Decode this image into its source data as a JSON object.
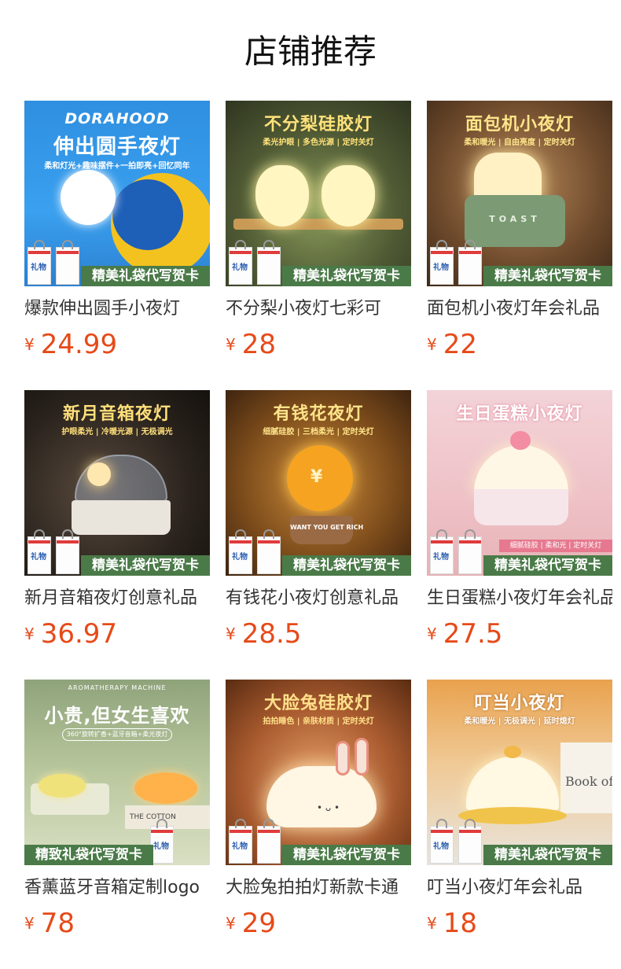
{
  "page": {
    "title": "店铺推荐"
  },
  "gift_banner": "精美礼袋代写贺卡",
  "products": [
    {
      "name": "爆款伸出圆手小夜灯",
      "currency": "¥",
      "price": "24.99",
      "image": {
        "brand": "DORAHOOD",
        "headline": "伸出圆手夜灯",
        "subline": "柔和灯光+趣味摆件+一拍即亮+回忆同年",
        "theme": "blue"
      }
    },
    {
      "name": "不分梨小夜灯七彩可",
      "currency": "¥",
      "price": "28",
      "image": {
        "headline": "不分梨硅胶灯",
        "subline": "柔光护眼 | 多色光源 | 定时关灯",
        "theme": "green-amber"
      }
    },
    {
      "name": "面包机小夜灯年会礼品",
      "currency": "¥",
      "price": "22",
      "image": {
        "headline": "面包机小夜灯",
        "subline": "柔和暖光 | 自由亮度 | 定时关灯",
        "theme": "warm-brown",
        "product_text": "TOAST"
      }
    },
    {
      "name": "新月音箱夜灯创意礼品",
      "currency": "¥",
      "price": "36.97",
      "image": {
        "headline": "新月音箱夜灯",
        "subline": "护眼柔光 | 冷暖光源 | 无极调光",
        "theme": "dark"
      }
    },
    {
      "name": "有钱花小夜灯创意礼品",
      "currency": "¥",
      "price": "28.5",
      "image": {
        "headline": "有钱花夜灯",
        "subline": "细腻硅胶 | 三档柔光 | 定时关灯",
        "theme": "orange",
        "product_text": "WANT YOU GET RICH"
      }
    },
    {
      "name": "生日蛋糕小夜灯年会礼品",
      "currency": "¥",
      "price": "27.5",
      "image": {
        "headline": "生日蛋糕小夜灯",
        "subline": "细腻硅胶 | 柔和光 | 定时关灯",
        "theme": "pink"
      }
    },
    {
      "name": "香薰蓝牙音箱定制logo",
      "currency": "¥",
      "price": "78",
      "banner": "精致礼袋代写贺卡",
      "image": {
        "top_text": "AROMATHERAPY MACHINE",
        "headline": "小贵,但女生喜欢",
        "subline": "360°旋转扩香+蓝牙音箱+柔光夜灯",
        "theme": "mint",
        "product_text": "THE COTTON"
      }
    },
    {
      "name": "大脸兔拍拍灯新款卡通",
      "currency": "¥",
      "price": "29",
      "image": {
        "headline": "大脸兔硅胶灯",
        "subline": "拍拍睡色 | 亲肤材质 | 定时关灯",
        "theme": "peach"
      }
    },
    {
      "name": "叮当小夜灯年会礼品",
      "currency": "¥",
      "price": "18",
      "image": {
        "headline": "叮当小夜灯",
        "subline": "柔和暖光 | 无极调光 | 延时熄灯",
        "theme": "cream",
        "product_text": "Book of"
      }
    }
  ],
  "colors": {
    "price": "#e64a19",
    "banner": "#4a7a48"
  }
}
